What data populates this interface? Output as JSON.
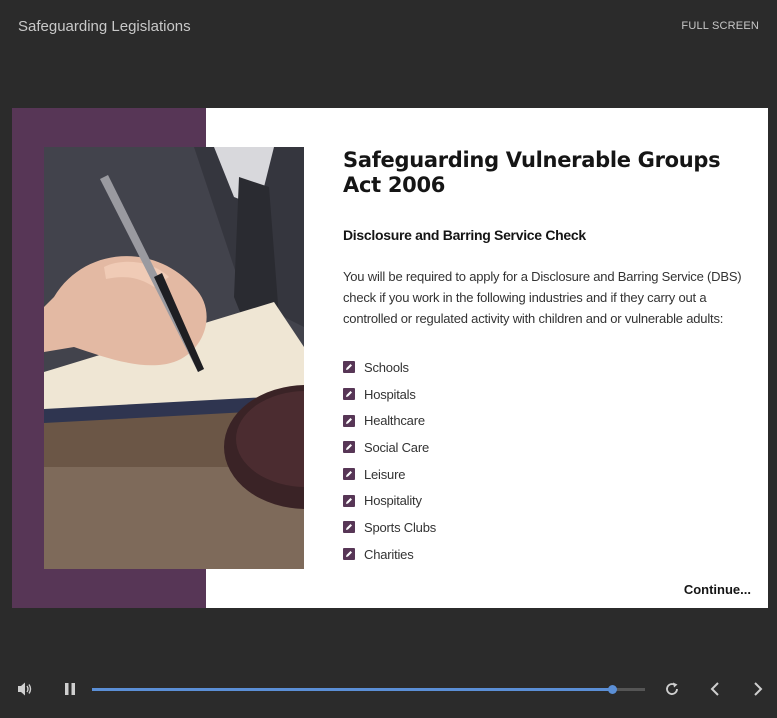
{
  "header": {
    "title": "Safeguarding Legislations",
    "fullscreen_label": "FULL SCREEN"
  },
  "slide": {
    "heading": "Safeguarding Vulnerable Groups Act 2006",
    "subheading": "Disclosure and Barring Service Check",
    "body": "You will be required to apply for a Disclosure and Barring Service (DBS) check if you work in the following industries and if they carry out a controlled or regulated activity with children and or vulnerable adults:",
    "items": [
      "Schools",
      "Hospitals",
      "Healthcare",
      "Social Care",
      "Leisure",
      "Hospitality",
      "Sports Clubs",
      "Charities"
    ],
    "continue_label": "Continue..."
  },
  "player": {
    "progress": 0.94,
    "icons": [
      "volume-icon",
      "pause-icon",
      "replay-icon",
      "previous-icon",
      "next-icon"
    ]
  },
  "colors": {
    "background": "#2b2b2b",
    "accent_purple": "#573656",
    "progress_blue": "#5b8fd6"
  }
}
